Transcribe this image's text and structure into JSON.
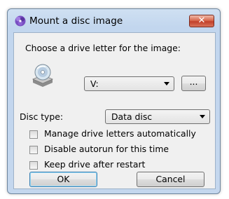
{
  "dialog": {
    "title": "Mount a disc image",
    "close_label": "✕"
  },
  "drive": {
    "prompt": "Choose a drive letter for the image:",
    "selected": "V:",
    "browse_label": "..."
  },
  "disc_type": {
    "label": "Disc type:",
    "selected": "Data disc"
  },
  "options": [
    {
      "label": "Manage drive letters automatically",
      "checked": false
    },
    {
      "label": "Disable autorun for this time",
      "checked": false
    },
    {
      "label": "Keep drive after restart",
      "checked": false
    }
  ],
  "buttons": {
    "ok": "OK",
    "cancel": "Cancel"
  },
  "colors": {
    "frame_blue": "#c4d7ee",
    "close_red": "#c2402a",
    "dialog_bg": "#f0f0f0",
    "default_border": "#3c7fb1"
  }
}
